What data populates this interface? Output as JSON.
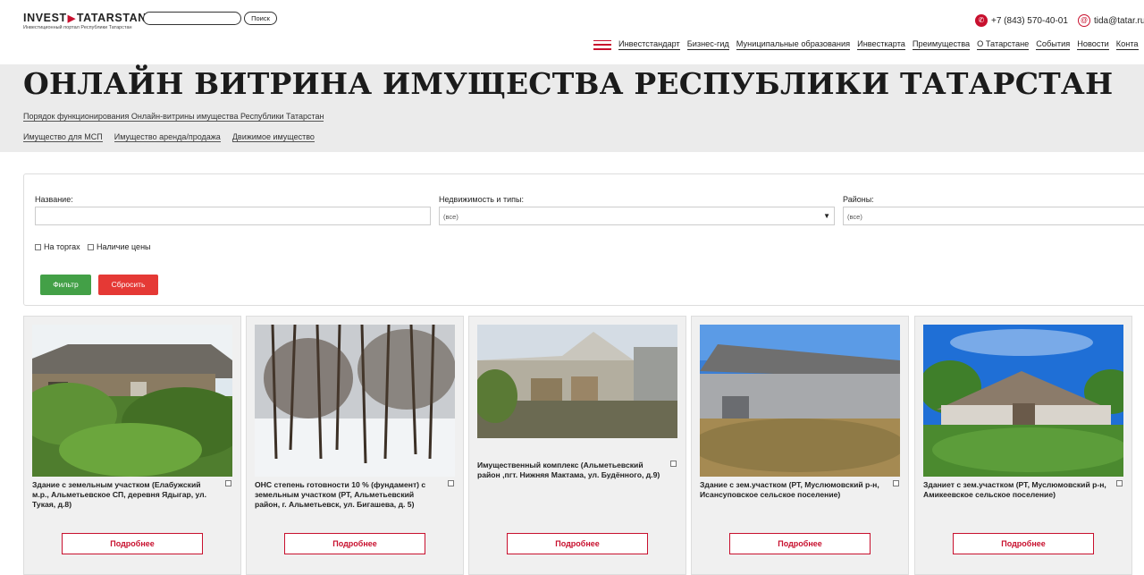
{
  "header": {
    "logo_main_left": "INVEST",
    "logo_arrow": "▶",
    "logo_main_right": "TATARSTAN",
    "logo_sub": "Инвестиционный портал Республики Татарстан",
    "search_placeholder": "",
    "search_button": "Поиск",
    "phone": "+7 (843) 570-40-01",
    "email": "tida@tatar.ru",
    "nav": [
      "Инвестстандарт",
      "Бизнес-гид",
      "Муниципальные образования",
      "Инвесткарта",
      "Преимущества",
      "О Татарстане",
      "События",
      "Новости",
      "Конта"
    ]
  },
  "hero": {
    "title": "ОНЛАЙН ВИТРИНА ИМУЩЕСТВА РЕСПУБЛИКИ ТАТАРСТАН",
    "procedure_link": "Порядок функционирования Онлайн-витрины имущества Республики Татарстан",
    "tabs": [
      "Имущество для МСП",
      "Имущество аренда/продажа",
      "Движимое имущество"
    ]
  },
  "filter": {
    "name_label": "Название:",
    "name_value": "",
    "type_label": "Недвижимость и типы:",
    "type_value": "(все)",
    "district_label": "Районы:",
    "district_value": "(все)",
    "checkbox_auction": "На торгах",
    "checkbox_price": "Наличие цены",
    "filter_button": "Фильтр",
    "reset_button": "Сбросить"
  },
  "cards": [
    {
      "title": "Здание с земельным участком (Елабужский м.р., Альметьевское СП, деревня Ядыгар, ул. Тукая, д.8)",
      "button": "Подробнее"
    },
    {
      "title": "ОНС степень готовности 10 % (фундамент) с земельным участком (РТ, Альметьевский район, г. Альметьевск, ул. Бигашева, д. 5)",
      "button": "Подробнее"
    },
    {
      "title": "Имущественный комплекс (Альметьевский район ,пгт. Нижняя Мактама, ул. Будённого, д.9)",
      "button": "Подробнее"
    },
    {
      "title": "Здание с зем.участком (РТ, Муслюмовский р-н, Исансуповское сельское поселение)",
      "button": "Подробнее"
    },
    {
      "title": "Зданиет с зем.участком (РТ, Муслюмовский р-н, Амикеевское сельское поселение)",
      "button": "Подробнее"
    }
  ],
  "icons": {
    "phone": "phone-icon",
    "email": "at-icon",
    "menu": "burger-menu-icon",
    "dropdown": "caret-down-icon"
  },
  "colors": {
    "brand_red": "#c8102e",
    "filter_green": "#43a047",
    "reset_red": "#e53935",
    "hero_bg": "#ebebeb"
  }
}
